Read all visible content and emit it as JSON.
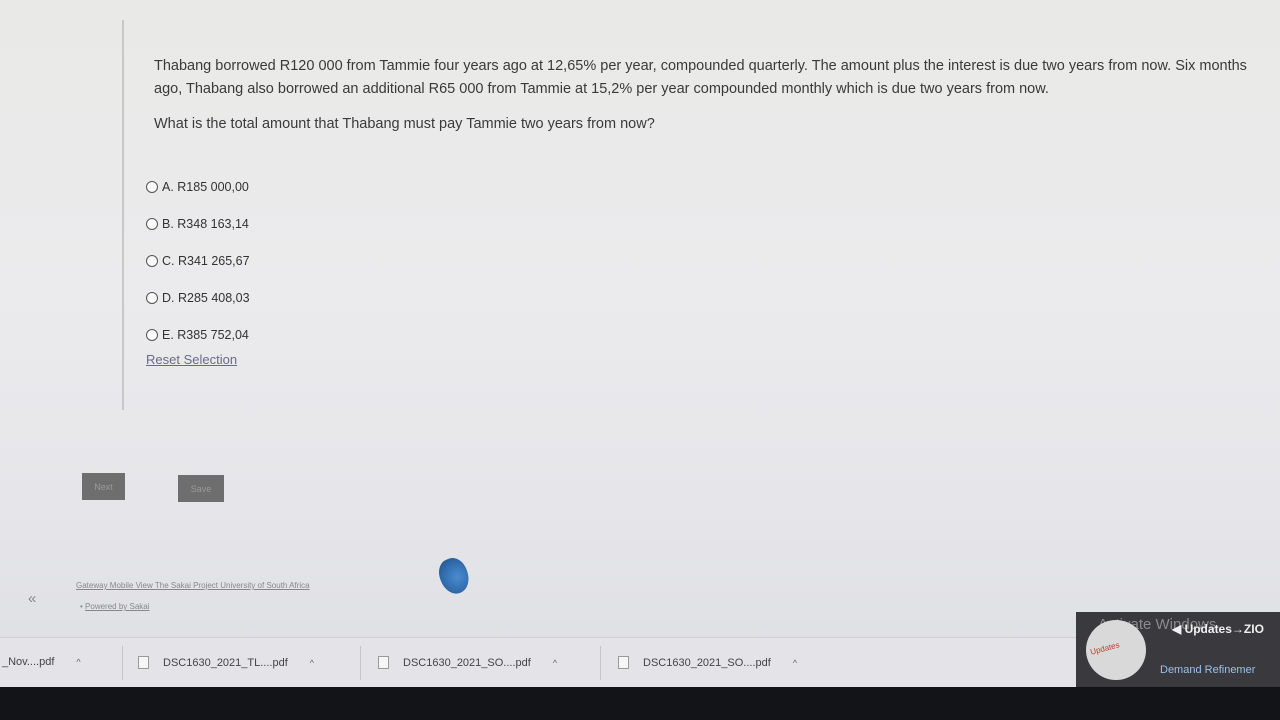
{
  "question": {
    "paragraph1": "Thabang borrowed R120 000 from Tammie four years ago at 12,65% per year, compounded quarterly. The amount plus the interest is due two years from now. Six months ago, Thabang also borrowed an additional R65 000 from Tammie at 15,2% per year compounded monthly which is due two years from now.",
    "paragraph2": "What is the total amount that Thabang must pay Tammie two years from now?"
  },
  "options": [
    {
      "label": "A. R185 000,00"
    },
    {
      "label": "B. R348 163,14"
    },
    {
      "label": "C. R341 265,67"
    },
    {
      "label": "D. R285 408,03"
    },
    {
      "label": "E. R385 752,04"
    }
  ],
  "reset_label": "Reset Selection",
  "buttons": {
    "next": "Next",
    "save": "Save"
  },
  "footer": {
    "links": "Gateway Mobile View The Sakai Project University of South Africa",
    "powered": "Powered by Sakai"
  },
  "sidebar": {
    "collapse": "«"
  },
  "downloads": [
    {
      "name": "_Nov....pdf"
    },
    {
      "name": "DSC1630_2021_TL....pdf"
    },
    {
      "name": "DSC1630_2021_SO....pdf"
    },
    {
      "name": "DSC1630_2021_SO....pdf"
    }
  ],
  "notification": {
    "watermark": "Activate Windows",
    "title": "◀ Updates→ZIO",
    "subtitle": "Demand Refinemer",
    "logo_text": "Updates"
  },
  "icons": {
    "radio": "radio-circle-icon",
    "file": "file-icon",
    "chevron": "chevron-up-icon"
  },
  "colors": {
    "background": "#e9e9e7",
    "link": "#6a6a8a",
    "button": "#6e6e6e",
    "taskbar": "#121418"
  }
}
